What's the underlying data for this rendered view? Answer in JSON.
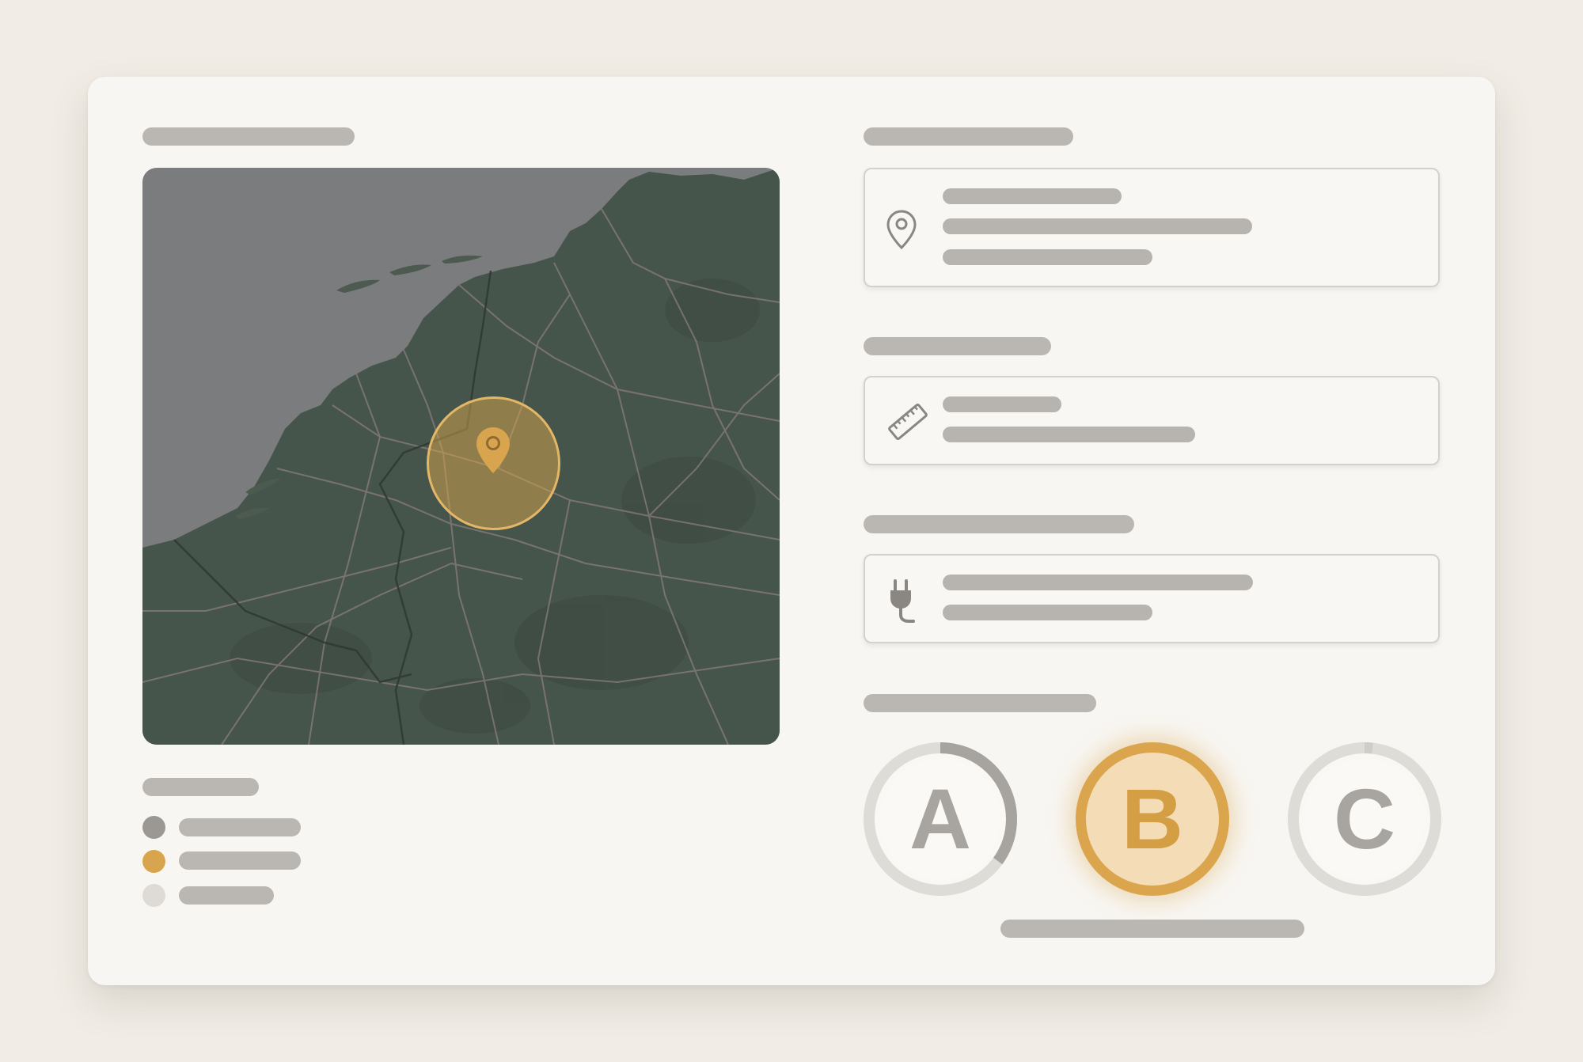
{
  "colors": {
    "accent": "#d8a54e",
    "placeholder": "#bab7b2",
    "map_land": "#46554b",
    "map_water": "#7b7c7d"
  },
  "map": {
    "marker_icon": "map-pin-icon"
  },
  "details": {
    "location_icon": "map-pin-outline-icon",
    "distance_icon": "ruler-icon",
    "connector_icon": "plug-icon"
  },
  "legend": {
    "items": [
      {
        "color": "#9b9893"
      },
      {
        "color": "#d8a54e"
      },
      {
        "color": "#dedbd6"
      }
    ]
  },
  "options": {
    "items": [
      {
        "label": "A",
        "selected": false,
        "progress": 0.35
      },
      {
        "label": "B",
        "selected": true,
        "progress": 1.0
      },
      {
        "label": "C",
        "selected": false,
        "progress": 0.02
      }
    ]
  }
}
